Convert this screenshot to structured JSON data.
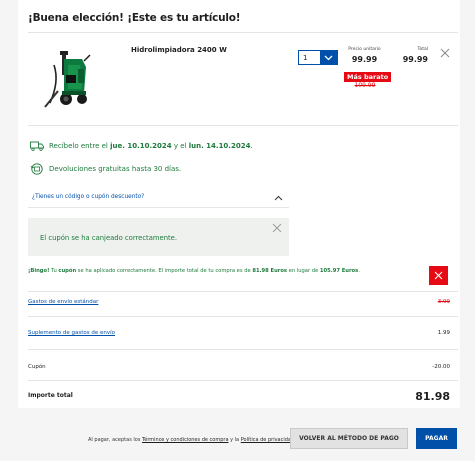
{
  "header": {
    "title": "¡Buena elección! ¡Este es tu artículo!"
  },
  "product": {
    "name": "Hidrolimpiadora 2400 W",
    "quantity": "1",
    "unit_price_label": "Precio unitario",
    "unit_price": "99.99",
    "total_label": "Total",
    "total": "99.99",
    "cheaper_badge": "Más barato",
    "old_price": "109.99",
    "image_icon": "pressure-washer-image"
  },
  "delivery": {
    "prefix": "Recíbelo entre el",
    "date_from": "jue. 10.10.2024",
    "middle": "y el",
    "date_to": "lun. 14.10.2024",
    "suffix": "."
  },
  "returns": {
    "text": "Devoluciones gratuitas hasta 30 días."
  },
  "coupon": {
    "question": "¿Tienes un código o cupón descuento?",
    "success_message": "El cupón se ha canjeado correctamente."
  },
  "bingo": {
    "part1": "¡Bingo!",
    "part2": " Tu ",
    "part3": "cupón",
    "part4": " se ha aplicado correctamente. El importe total de tu compra es de ",
    "amount_new": "81.98 Euros",
    "part5": " en lugar de ",
    "amount_old": "105.97 Euros",
    "part6": "."
  },
  "summary": {
    "shipping_label": "Gastos de envío estándar",
    "shipping_value": "3.99",
    "supplement_label": "Suplemento de gastos de envío",
    "supplement_value": "1.99",
    "coupon_label": "Cupón",
    "coupon_value": "-20.00",
    "total_label": "Importe total",
    "total_value": "81.98"
  },
  "footer": {
    "prefix": "Al pagar, aceptas los ",
    "terms_link": "Términos y condiciones de compra",
    "middle": " y la ",
    "privacy_link": "Política de privacidad",
    "suffix": ".",
    "back_button": "VOLVER AL MÉTODO DE PAGO",
    "pay_button": "PAGAR"
  },
  "colors": {
    "brand_blue": "#0050aa",
    "alert_red": "#e60a14",
    "success_green": "#1d7a3b"
  }
}
